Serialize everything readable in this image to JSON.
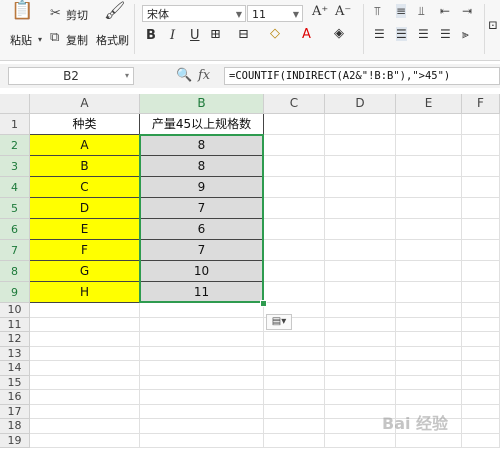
{
  "ribbon": {
    "cut_label": "剪切",
    "paste_label": "粘贴",
    "copy_label": "复制",
    "format_painter_label": "格式刷",
    "font_name": "宋体",
    "font_size": "11",
    "bold": "B",
    "italic": "I",
    "underline": "U"
  },
  "formula_bar": {
    "name_box": "B2",
    "fx": "fx",
    "formula": "=COUNTIF(INDIRECT(A2&\"!B:B\"),\">45\")"
  },
  "columns": [
    "A",
    "B",
    "C",
    "D",
    "E",
    "F"
  ],
  "rows": [
    "1",
    "2",
    "3",
    "4",
    "5",
    "6",
    "7",
    "8",
    "9",
    "10",
    "11",
    "12",
    "13",
    "14",
    "15",
    "16",
    "17",
    "18",
    "19"
  ],
  "table": {
    "header_a": "种类",
    "header_b": "产量45以上规格数",
    "data": [
      {
        "a": "A",
        "b": "8"
      },
      {
        "a": "B",
        "b": "8"
      },
      {
        "a": "C",
        "b": "9"
      },
      {
        "a": "D",
        "b": "7"
      },
      {
        "a": "E",
        "b": "6"
      },
      {
        "a": "F",
        "b": "7"
      },
      {
        "a": "G",
        "b": "10"
      },
      {
        "a": "H",
        "b": "11"
      }
    ]
  },
  "watermark": "Bai 经验"
}
